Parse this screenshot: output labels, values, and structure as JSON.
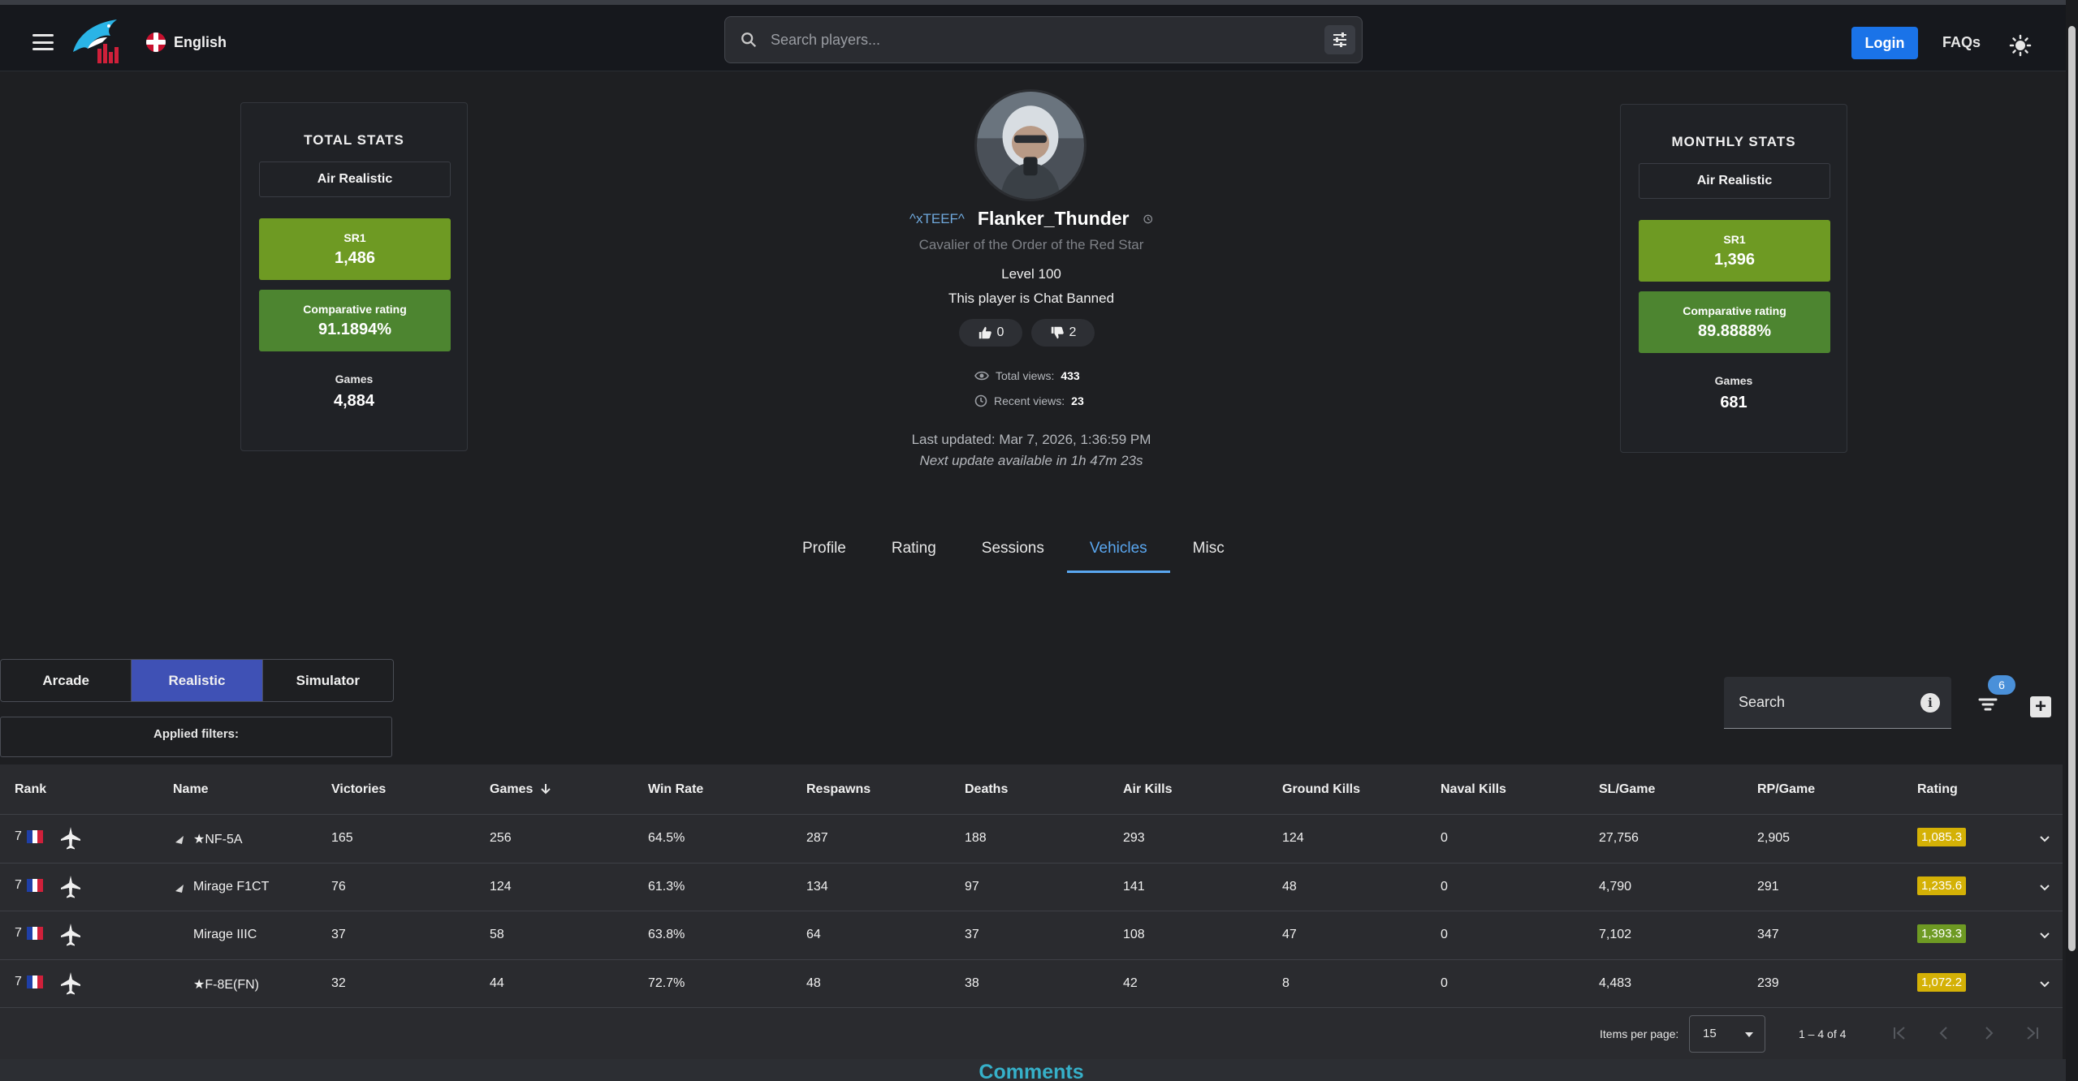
{
  "header": {
    "language": "English",
    "search_placeholder": "Search players...",
    "login_label": "Login",
    "faqs_label": "FAQs"
  },
  "total_stats": {
    "title": "TOTAL STATS",
    "mode": "Air Realistic",
    "sr_label": "SR1",
    "sr_value": "1,486",
    "cr_label": "Comparative rating",
    "cr_value": "91.1894%",
    "games_label": "Games",
    "games_value": "4,884"
  },
  "monthly_stats": {
    "title": "MONTHLY STATS",
    "mode": "Air Realistic",
    "sr_label": "SR1",
    "sr_value": "1,396",
    "cr_label": "Comparative rating",
    "cr_value": "89.8888%",
    "games_label": "Games",
    "games_value": "681"
  },
  "profile": {
    "clan": "^xTEEF^",
    "name": "Flanker_Thunder",
    "title": "Cavalier of the Order of the Red Star",
    "level": "Level 100",
    "ban_status": "This player is Chat Banned",
    "likes": "0",
    "dislikes": "2",
    "total_views_label": "Total views:",
    "total_views": "433",
    "recent_views_label": "Recent views:",
    "recent_views": "23",
    "last_updated": "Last updated: Mar 7, 2026, 1:36:59 PM",
    "next_update": "Next update available in 1h 47m 23s"
  },
  "tabs": [
    {
      "label": "Profile"
    },
    {
      "label": "Rating"
    },
    {
      "label": "Sessions"
    },
    {
      "label": "Vehicles",
      "active": true
    },
    {
      "label": "Misc"
    }
  ],
  "modes": [
    {
      "label": "Arcade"
    },
    {
      "label": "Realistic",
      "active": true
    },
    {
      "label": "Simulator"
    }
  ],
  "applied_filters_label": "Applied filters:",
  "table_search_label": "Search",
  "filter_badge": "6",
  "colors": {
    "accent": "#5aa7f0",
    "mode_active": "#3f51b5",
    "sr_green": "#6e9a23",
    "cr_green": "#4d8530",
    "rating_yellow": "#d4b106",
    "rating_green": "#6e9a23",
    "login_blue": "#1a73e8"
  },
  "table": {
    "columns": [
      "Rank",
      "Name",
      "Victories",
      "Games",
      "Win Rate",
      "Respawns",
      "Deaths",
      "Air Kills",
      "Ground Kills",
      "Naval Kills",
      "SL/Game",
      "RP/Game",
      "Rating"
    ],
    "sort_column": "Games",
    "rows": [
      {
        "rank": "7",
        "name": "★NF-5A",
        "prefix_icon": "premium-icon",
        "victories": "165",
        "games": "256",
        "win_rate": "64.5%",
        "respawns": "287",
        "deaths": "188",
        "air_kills": "293",
        "ground_kills": "124",
        "naval_kills": "0",
        "sl_game": "27,756",
        "rp_game": "2,905",
        "rating": "1,085.3",
        "rating_color": "yellow"
      },
      {
        "rank": "7",
        "name": "Mirage F1CT",
        "prefix_icon": "squadron-icon",
        "victories": "76",
        "games": "124",
        "win_rate": "61.3%",
        "respawns": "134",
        "deaths": "97",
        "air_kills": "141",
        "ground_kills": "48",
        "naval_kills": "0",
        "sl_game": "4,790",
        "rp_game": "291",
        "rating": "1,235.6",
        "rating_color": "yellow"
      },
      {
        "rank": "7",
        "name": "Mirage IIIC",
        "prefix_icon": "",
        "victories": "37",
        "games": "58",
        "win_rate": "63.8%",
        "respawns": "64",
        "deaths": "37",
        "air_kills": "108",
        "ground_kills": "47",
        "naval_kills": "0",
        "sl_game": "7,102",
        "rp_game": "347",
        "rating": "1,393.3",
        "rating_color": "green"
      },
      {
        "rank": "7",
        "name": "★F-8E(FN)",
        "prefix_icon": "",
        "victories": "32",
        "games": "44",
        "win_rate": "72.7%",
        "respawns": "48",
        "deaths": "38",
        "air_kills": "42",
        "ground_kills": "8",
        "naval_kills": "0",
        "sl_game": "4,483",
        "rp_game": "239",
        "rating": "1,072.2",
        "rating_color": "yellow"
      }
    ]
  },
  "pagination": {
    "items_per_page_label": "Items per page:",
    "items_per_page": "15",
    "range": "1 – 4 of 4"
  },
  "comments_label": "Comments"
}
